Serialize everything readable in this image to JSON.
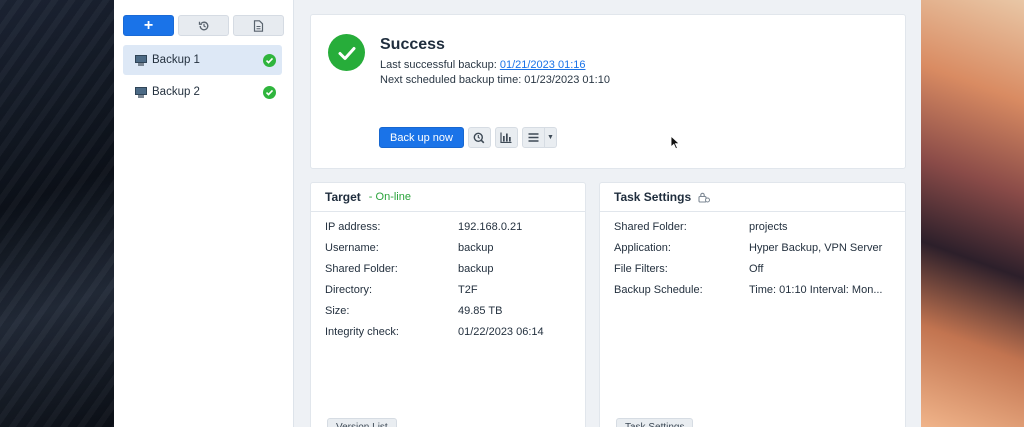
{
  "sidebar": {
    "toolbar": [
      {
        "name": "create-button",
        "icon": "plus-icon"
      },
      {
        "name": "restore-button",
        "icon": "history-icon"
      },
      {
        "name": "log-button",
        "icon": "document-icon"
      }
    ],
    "tasks": [
      {
        "label": "Backup 1",
        "icon": "computer-icon",
        "status": "success"
      },
      {
        "label": "Backup 2",
        "icon": "computer-icon",
        "status": "success"
      }
    ]
  },
  "status": {
    "title": "Success",
    "last_label": "Last successful backup: ",
    "last_value": "01/21/2023 01:16",
    "next_text": "Next scheduled backup time: 01/23/2023 01:10",
    "backup_now_label": "Back up now",
    "icon_buttons": [
      "integrity-check-icon",
      "statistics-icon",
      "menu-icon"
    ],
    "color": "#27ad3a"
  },
  "target": {
    "title": "Target",
    "state": "- On-line",
    "rows": [
      {
        "key": "IP address:",
        "value": "192.168.0.21"
      },
      {
        "key": "Username:",
        "value": "backup"
      },
      {
        "key": "Shared Folder:",
        "value": "backup"
      },
      {
        "key": "Directory:",
        "value": "T2F"
      },
      {
        "key": "Size:",
        "value": "49.85 TB"
      },
      {
        "key": "Integrity check:",
        "value": "01/22/2023 06:14"
      }
    ],
    "bottom_button": "Version List"
  },
  "task_settings": {
    "title": "Task Settings",
    "title_icon": "lock-icon",
    "rows": [
      {
        "key": "Shared Folder:",
        "value": "projects"
      },
      {
        "key": "Application:",
        "value": "Hyper Backup, VPN Server"
      },
      {
        "key": "File Filters:",
        "value": "Off"
      },
      {
        "key": "Backup Schedule:",
        "value": "Time: 01:10 Interval: Mon..."
      }
    ],
    "bottom_button": "Task Settings"
  }
}
